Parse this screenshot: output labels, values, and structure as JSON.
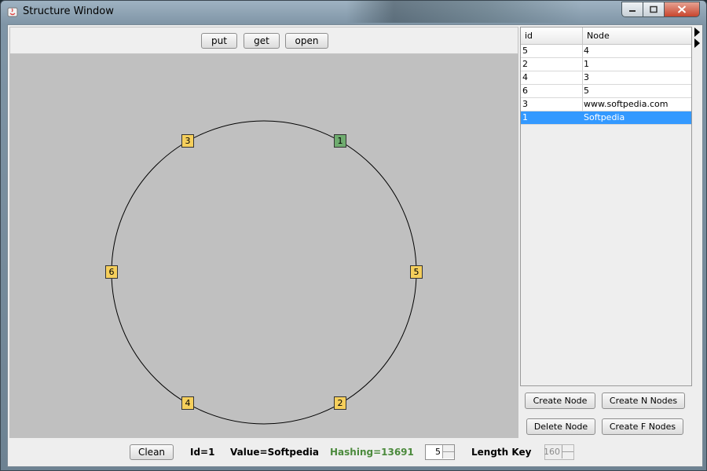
{
  "window": {
    "title": "Structure Window",
    "controls": [
      "minimize-icon",
      "maximize-icon",
      "close-icon"
    ]
  },
  "toolbar": {
    "put_label": "put",
    "get_label": "get",
    "open_label": "open"
  },
  "ring": {
    "nodes": [
      {
        "label": "1",
        "angle_deg": 60,
        "active": true
      },
      {
        "label": "5",
        "angle_deg": 0,
        "active": false
      },
      {
        "label": "2",
        "angle_deg": -60,
        "active": false
      },
      {
        "label": "4",
        "angle_deg": -120,
        "active": false
      },
      {
        "label": "6",
        "angle_deg": 180,
        "active": false
      },
      {
        "label": "3",
        "angle_deg": 120,
        "active": false
      }
    ],
    "colors": {
      "node": "#f5cf5c",
      "active_node": "#6fac6f",
      "background": "#c0c0c0"
    }
  },
  "table": {
    "headers": {
      "id": "id",
      "node": "Node"
    },
    "rows": [
      {
        "id": "5",
        "node": "4",
        "selected": false
      },
      {
        "id": "2",
        "node": "1",
        "selected": false
      },
      {
        "id": "4",
        "node": "3",
        "selected": false
      },
      {
        "id": "6",
        "node": "5",
        "selected": false
      },
      {
        "id": "3",
        "node": "www.softpedia.com",
        "selected": false
      },
      {
        "id": "1",
        "node": "Softpedia",
        "selected": true
      }
    ],
    "selection_color": "#3399ff"
  },
  "actions": {
    "create_node": "Create Node",
    "create_n_nodes": "Create N Nodes",
    "delete_node": "Delete Node",
    "create_f_nodes": "Create F Nodes"
  },
  "status": {
    "clean_label": "Clean",
    "id_text": "Id=1",
    "value_text": "Value=Softpedia",
    "hashing_text": "Hashing=13691",
    "hashing_color": "#4b8a3c",
    "spinner_value": "5",
    "length_key_label": "Length Key",
    "length_key_value": "160"
  }
}
